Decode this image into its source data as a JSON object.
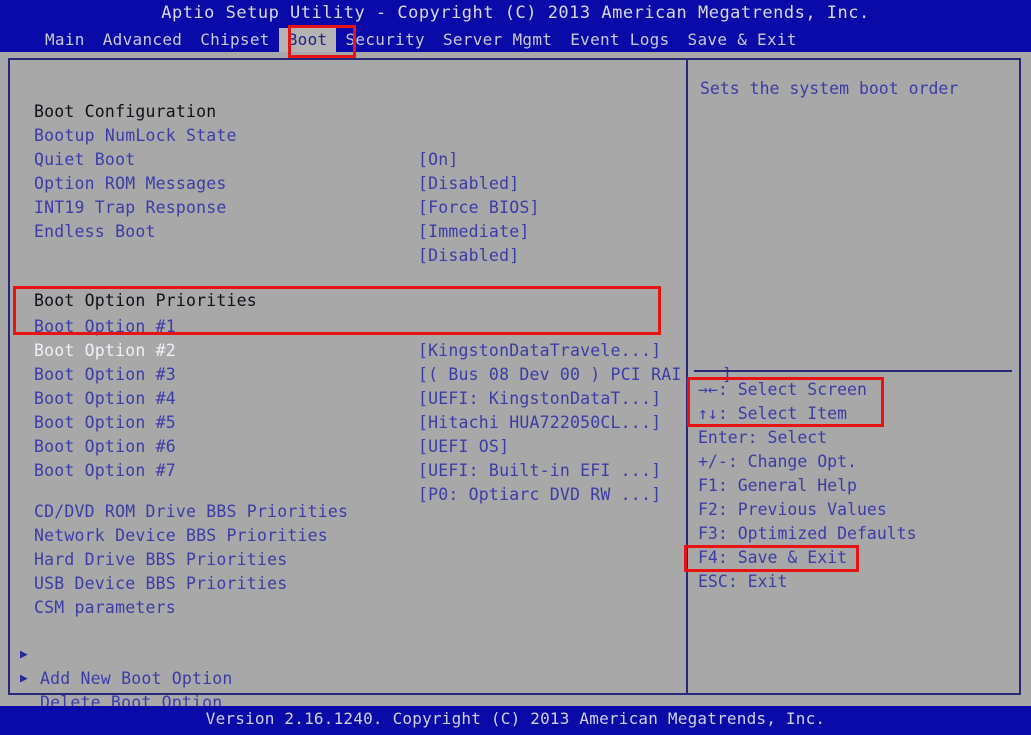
{
  "banner": {
    "title": "Aptio Setup Utility - Copyright (C) 2013 American Megatrends, Inc."
  },
  "menu": {
    "items": [
      {
        "label": "Main",
        "active": false
      },
      {
        "label": "Advanced",
        "active": false
      },
      {
        "label": "Chipset",
        "active": false
      },
      {
        "label": "Boot",
        "active": true
      },
      {
        "label": "Security",
        "active": false
      },
      {
        "label": "Server Mgmt",
        "active": false
      },
      {
        "label": "Event Logs",
        "active": false
      },
      {
        "label": "Save & Exit",
        "active": false
      }
    ]
  },
  "left_pane": {
    "section_boot_configuration": "Boot Configuration",
    "boot_configuration": [
      {
        "label": "Bootup NumLock State",
        "value": "[On]"
      },
      {
        "label": "Quiet Boot",
        "value": "[Disabled]"
      },
      {
        "label": "Option ROM Messages",
        "value": "[Force BIOS]"
      },
      {
        "label": "INT19 Trap Response",
        "value": "[Immediate]"
      },
      {
        "label": "Endless Boot",
        "value": "[Disabled]"
      }
    ],
    "section_boot_option_priorities": "Boot Option Priorities",
    "boot_options": [
      {
        "label": "Boot Option #1",
        "value": "[KingstonDataTravele...]",
        "selected": false
      },
      {
        "label": "Boot Option #2",
        "value": "[( Bus 08 Dev 00 ) PCI RAI ...]",
        "selected": true
      },
      {
        "label": "Boot Option #3",
        "value": "[UEFI: KingstonDataT...]",
        "selected": false
      },
      {
        "label": "Boot Option #4",
        "value": "[Hitachi HUA722050CL...]",
        "selected": false
      },
      {
        "label": "Boot Option #5",
        "value": "[UEFI OS]",
        "selected": false
      },
      {
        "label": "Boot Option #6",
        "value": "[UEFI: Built-in EFI ...]",
        "selected": false
      },
      {
        "label": "Boot Option #7",
        "value": "[P0: Optiarc DVD RW ...]",
        "selected": false
      }
    ],
    "bbs_priorities": [
      "CD/DVD ROM Drive BBS Priorities",
      "Network Device BBS Priorities",
      "Hard Drive BBS Priorities",
      "USB Device BBS Priorities",
      "CSM parameters"
    ],
    "submenu_items": [
      {
        "bullet": "▶",
        "label": "Add New Boot Option"
      },
      {
        "bullet": "▶",
        "label": "Delete Boot Option"
      }
    ]
  },
  "right_pane": {
    "help_text": "Sets the system boot order",
    "key_legend": [
      {
        "key": "→←",
        "text": ": Select Screen"
      },
      {
        "key": "↑↓",
        "text": ": Select Item"
      },
      {
        "key": "Enter",
        "text": ": Select"
      },
      {
        "key": "+/-",
        "text": ": Change Opt."
      },
      {
        "key": "F1",
        "text": ": General Help"
      },
      {
        "key": "F2",
        "text": ": Previous Values"
      },
      {
        "key": "F3",
        "text": ": Optimized Defaults"
      },
      {
        "key": "F4",
        "text": ": Save & Exit"
      },
      {
        "key": "ESC",
        "text": ": Exit"
      }
    ]
  },
  "footer": {
    "version": "Version 2.16.1240. Copyright (C) 2013 American Megatrends, Inc."
  },
  "annotations": {
    "accent_color": "#e81414",
    "boxes": [
      {
        "name": "boot-tab-highlight"
      },
      {
        "name": "boot-options-1-2-highlight"
      },
      {
        "name": "select-screen-item-highlight"
      },
      {
        "name": "save-exit-key-highlight"
      }
    ]
  },
  "colors": {
    "banner_blue": "#0a0aa8",
    "background_gray": "#a8a8a8",
    "text_blue": "#3c3ca8",
    "text_dark": "#101018",
    "text_selected": "#f0f0f8",
    "border_blue": "#282878"
  }
}
